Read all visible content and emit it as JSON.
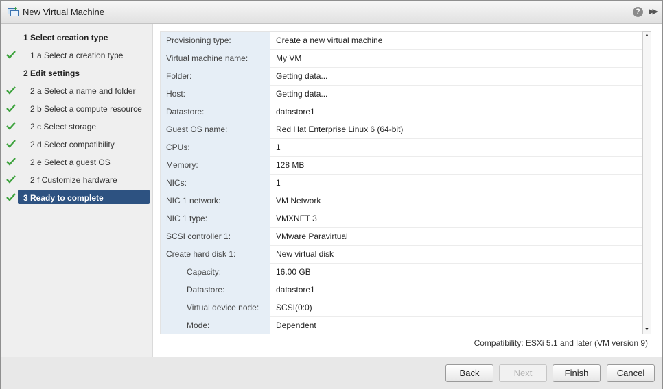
{
  "window": {
    "title": "New Virtual Machine",
    "help_glyph": "?",
    "expand_glyph": "▶▶"
  },
  "sidebar": {
    "steps": [
      {
        "label": "1  Select creation type",
        "kind": "heading",
        "checked": false
      },
      {
        "label": "1 a  Select a creation type",
        "kind": "sub",
        "checked": true
      },
      {
        "label": "2  Edit settings",
        "kind": "heading",
        "checked": false
      },
      {
        "label": "2 a  Select a name and folder",
        "kind": "sub",
        "checked": true
      },
      {
        "label": "2 b  Select a compute resource",
        "kind": "sub",
        "checked": true
      },
      {
        "label": "2 c  Select storage",
        "kind": "sub",
        "checked": true
      },
      {
        "label": "2 d  Select compatibility",
        "kind": "sub",
        "checked": true
      },
      {
        "label": "2 e  Select a guest OS",
        "kind": "sub",
        "checked": true
      },
      {
        "label": "2 f  Customize hardware",
        "kind": "sub",
        "checked": true
      },
      {
        "label": "3  Ready to complete",
        "kind": "heading",
        "checked": true,
        "active": true
      }
    ]
  },
  "summary": {
    "rows": [
      {
        "key": "Provisioning type:",
        "value": "Create a new virtual machine"
      },
      {
        "key": "Virtual machine name:",
        "value": "My VM"
      },
      {
        "key": "Folder:",
        "value": "Getting data..."
      },
      {
        "key": "Host:",
        "value": "Getting data..."
      },
      {
        "key": "Datastore:",
        "value": "datastore1"
      },
      {
        "key": "Guest OS name:",
        "value": "Red Hat Enterprise Linux 6 (64-bit)"
      },
      {
        "key": "CPUs:",
        "value": "1"
      },
      {
        "key": "Memory:",
        "value": "128 MB"
      },
      {
        "key": "NICs:",
        "value": "1"
      },
      {
        "key": "NIC 1 network:",
        "value": "VM Network"
      },
      {
        "key": "NIC 1 type:",
        "value": "VMXNET 3"
      },
      {
        "key": "SCSI controller 1:",
        "value": "VMware Paravirtual"
      },
      {
        "key": "Create hard disk 1:",
        "value": "New virtual disk"
      },
      {
        "key": "Capacity:",
        "value": "16.00 GB",
        "indent": true
      },
      {
        "key": "Datastore:",
        "value": "datastore1",
        "indent": true
      },
      {
        "key": "Virtual device node:",
        "value": "SCSI(0:0)",
        "indent": true
      },
      {
        "key": "Mode:",
        "value": "Dependent",
        "indent": true
      }
    ],
    "compatibility": "Compatibility: ESXi 5.1 and later (VM version 9)"
  },
  "footer": {
    "back_label": "Back",
    "next_label": "Next",
    "finish_label": "Finish",
    "cancel_label": "Cancel"
  },
  "colors": {
    "accent": "#2d5281",
    "check": "#3ea33e",
    "key_bg": "#e6eef6"
  }
}
